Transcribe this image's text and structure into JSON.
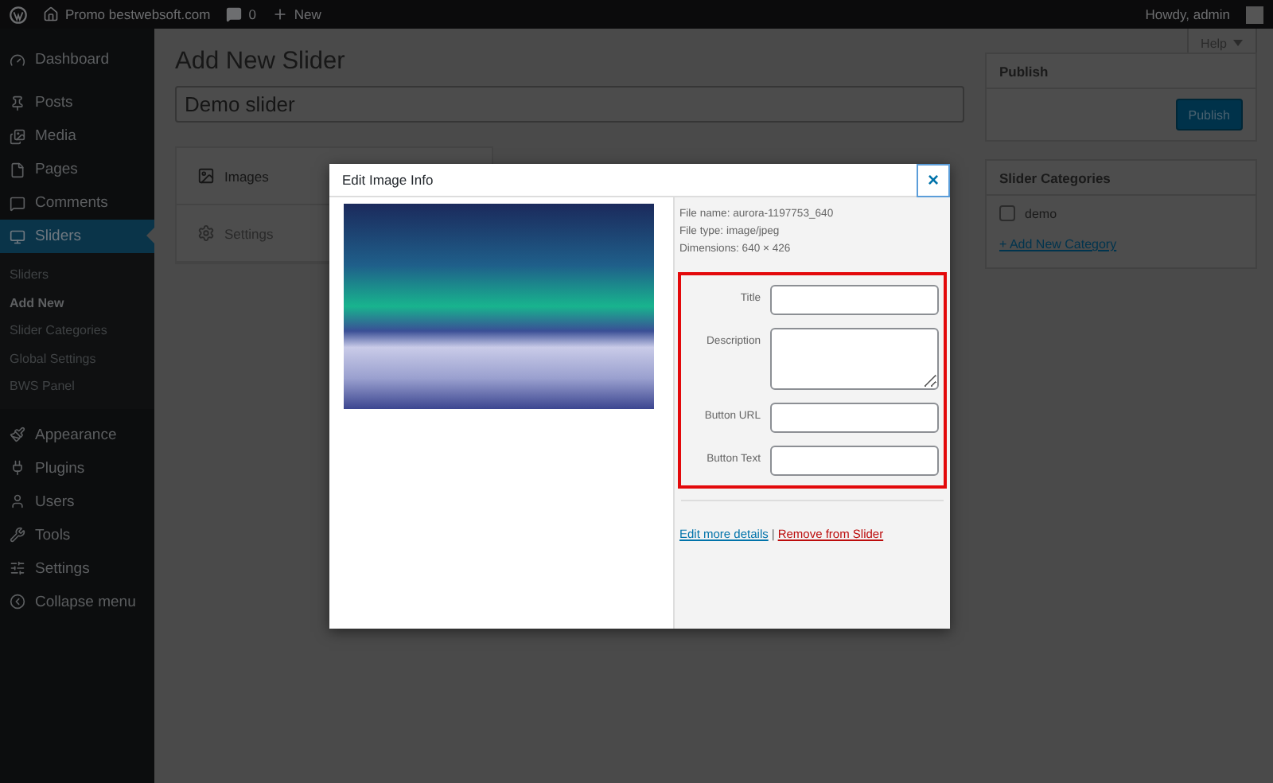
{
  "top_bar": {
    "site": "Promo bestwebsoft.com",
    "comments": "0",
    "new": "New",
    "greeting": "Howdy, admin"
  },
  "sidebar": {
    "items": [
      {
        "label": "Dashboard",
        "selected": false
      },
      {
        "label": "Posts",
        "selected": false
      },
      {
        "label": "Media",
        "selected": false
      },
      {
        "label": "Pages",
        "selected": false
      },
      {
        "label": "Comments",
        "selected": false
      },
      {
        "label": "Sliders",
        "selected": true,
        "submenu": [
          {
            "label": "Sliders",
            "selected": false
          },
          {
            "label": "Add New",
            "selected": true
          },
          {
            "label": "Slider Categories",
            "selected": false
          },
          {
            "label": "Global Settings",
            "selected": false
          },
          {
            "label": "BWS Panel",
            "selected": false
          }
        ]
      },
      {
        "label": "Appearance",
        "selected": false
      },
      {
        "label": "Plugins",
        "selected": false
      },
      {
        "label": "Users",
        "selected": false
      },
      {
        "label": "Tools",
        "selected": false
      },
      {
        "label": "Settings",
        "selected": false
      }
    ],
    "collapse": "Collapse menu"
  },
  "help": "Help",
  "page_title": "Add New Slider",
  "title_field": {
    "value": "Demo slider"
  },
  "tabs": [
    {
      "label": "Images",
      "selected": true
    },
    {
      "label": "Settings",
      "selected": false
    }
  ],
  "publish_box": {
    "title": "Publish",
    "button": "Publish"
  },
  "categories_box": {
    "title": "Slider Categories",
    "categories": [
      {
        "label": "demo",
        "checked": false
      }
    ],
    "add_link": "+ Add New Category"
  },
  "modal": {
    "title": "Edit Image Info",
    "close": "×",
    "file_info": [
      "File name: aurora-1197753_640",
      "File type: image/jpeg",
      "Dimensions: 640 × 426"
    ],
    "fields": [
      {
        "kind": "input",
        "label": "Title"
      },
      {
        "kind": "textarea",
        "label": "Description"
      },
      {
        "kind": "input",
        "label": "Button URL"
      },
      {
        "kind": "input",
        "label": "Button Text"
      }
    ],
    "edit_link": "Edit more details",
    "separator": "|",
    "remove_link": "Remove from Slider"
  }
}
